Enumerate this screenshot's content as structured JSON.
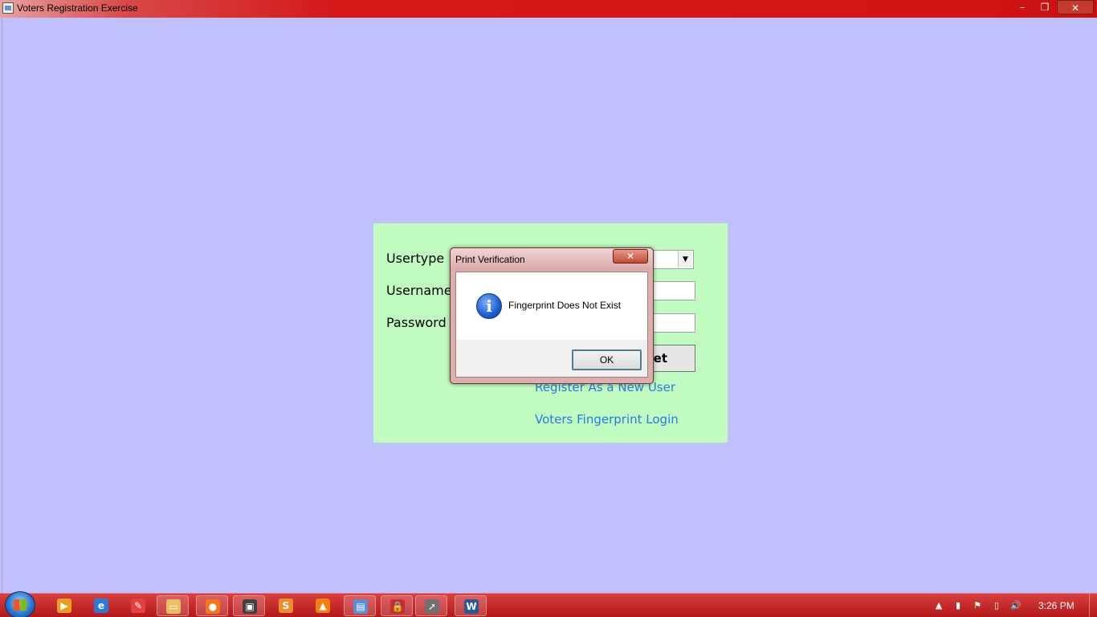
{
  "window": {
    "title": "Voters Registration Exercise",
    "controls": {
      "minimize": "–",
      "maximize": "❐",
      "close": "✕"
    }
  },
  "login_form": {
    "usertype_label": "Usertype",
    "username_label": "Username",
    "password_label": "Password",
    "usertype_value": "",
    "username_value": "",
    "password_value": "",
    "reset_button_label": "Reset",
    "register_link": "Register As a New User",
    "fingerprint_link": "Voters Fingerprint Login"
  },
  "dialog": {
    "title": "Print Verification",
    "message": "Fingerprint Does Not Exist",
    "ok_label": "OK",
    "icon": "information-icon",
    "close_glyph": "✕"
  },
  "taskbar": {
    "apps": [
      {
        "name": "media-player-icon",
        "glyph": "▶",
        "color": "#e8a020"
      },
      {
        "name": "internet-explorer-icon",
        "glyph": "e",
        "color": "#2a7ad8"
      },
      {
        "name": "paint-icon",
        "glyph": "✎",
        "color": "#e84040"
      },
      {
        "name": "file-explorer-icon",
        "glyph": "▭",
        "color": "#e8c060"
      },
      {
        "name": "firefox-icon",
        "glyph": "●",
        "color": "#f07818"
      },
      {
        "name": "movie-maker-icon",
        "glyph": "▣",
        "color": "#404040"
      },
      {
        "name": "sublime-icon",
        "glyph": "S",
        "color": "#e89030"
      },
      {
        "name": "vlc-icon",
        "glyph": "▲",
        "color": "#f08010"
      },
      {
        "name": "app-window-icon",
        "glyph": "▤",
        "color": "#5a8fd8"
      },
      {
        "name": "lock-icon",
        "glyph": "🔒",
        "color": "#c03030"
      },
      {
        "name": "cursor-app-icon",
        "glyph": "➚",
        "color": "#707070"
      },
      {
        "name": "word-icon",
        "glyph": "W",
        "color": "#2b5797"
      }
    ],
    "tray": {
      "show_hidden": "▲",
      "network": "▮",
      "action_center": "⚑",
      "battery": "▯",
      "volume": "🔊"
    },
    "clock": "3:26 PM"
  },
  "colors": {
    "desktop_bg": "#c0c0fc",
    "panel_bg": "#c0fcc0",
    "link": "#2878e8",
    "titlebar": "#d21414"
  }
}
